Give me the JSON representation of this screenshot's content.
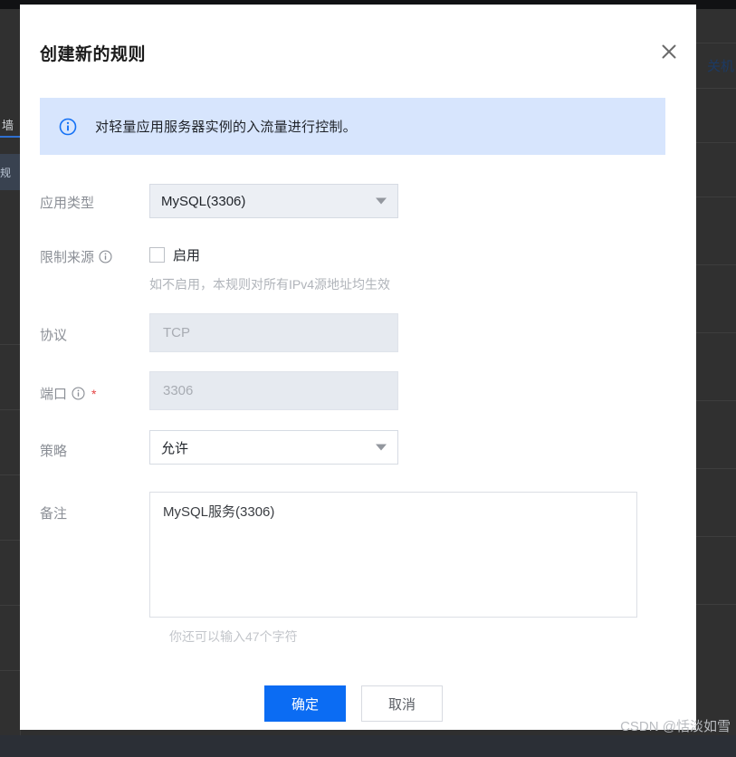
{
  "background": {
    "right_link_label": "关机",
    "left_tab_label": "墙",
    "left_selected_label": "规"
  },
  "watermark": "CSDN @恬淡如雪",
  "modal": {
    "title": "创建新的规则",
    "close_icon": "close-icon",
    "banner": {
      "icon": "info-circle-icon",
      "text": "对轻量应用服务器实例的入流量进行控制。"
    },
    "fields": {
      "app_type": {
        "label": "应用类型",
        "value": "MySQL(3306)",
        "arrow_icon": "chevron-down-icon"
      },
      "source_limit": {
        "label": "限制来源",
        "info_icon": "info-circle-icon",
        "checkbox_label": "启用",
        "checked": false,
        "hint": "如不启用，本规则对所有IPv4源地址均生效"
      },
      "protocol": {
        "label": "协议",
        "value": "TCP",
        "disabled": true
      },
      "port": {
        "label": "端口",
        "info_icon": "info-circle-icon",
        "required_mark": "*",
        "value": "3306",
        "disabled": true
      },
      "policy": {
        "label": "策略",
        "value": "允许",
        "arrow_icon": "chevron-down-icon"
      },
      "remark": {
        "label": "备注",
        "value": "MySQL服务(3306)",
        "counter": "你还可以输入47个字符"
      }
    },
    "buttons": {
      "confirm": "确定",
      "cancel": "取消"
    },
    "colors": {
      "primary": "#0b6cf3",
      "banner_bg": "#d7e5fd",
      "required": "#e54545"
    }
  }
}
